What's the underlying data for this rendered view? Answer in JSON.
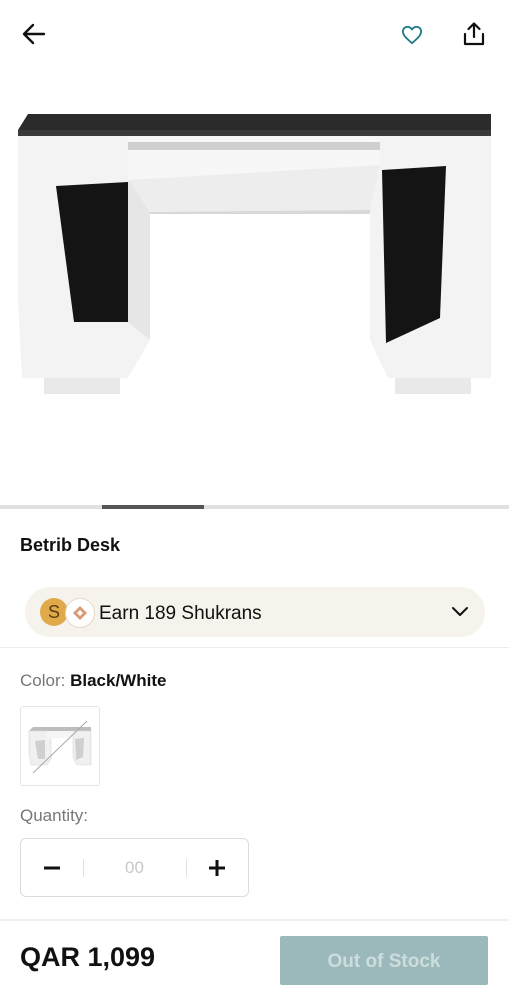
{
  "header": {
    "back_icon": "arrow-left-icon",
    "favorite_icon": "heart-outline-icon",
    "share_icon": "share-icon"
  },
  "gallery": {
    "image_alt": "Betrib Desk",
    "progress": 0.2,
    "current_slide": 2
  },
  "product": {
    "title": "Betrib Desk"
  },
  "shukran": {
    "coin_letter": "S",
    "text": "Earn 189 Shukrans",
    "chevron_icon": "chevron-down-icon"
  },
  "color": {
    "label": "Color:",
    "value": "Black/White"
  },
  "quantity": {
    "label": "Quantity:",
    "value": "00",
    "minus_icon": "minus-icon",
    "plus_icon": "plus-icon"
  },
  "footer": {
    "price": "QAR 1,099",
    "button_label": "Out of Stock"
  },
  "colors": {
    "accent": "#1f7b84",
    "disabled_button": "#9bb9ba",
    "shukran_bg": "#f6f2ec",
    "coin": "#e0a94a"
  }
}
